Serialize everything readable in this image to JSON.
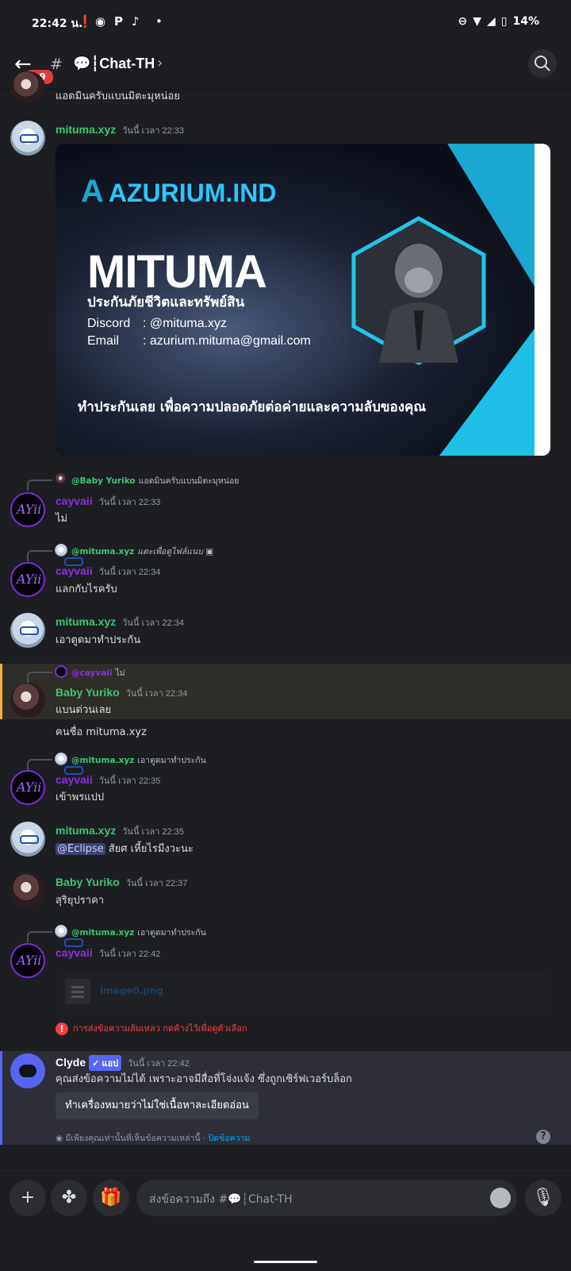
{
  "status": {
    "time": "22:42 น.",
    "battery": "14%"
  },
  "header": {
    "title": "💬┆Chat-TH",
    "badge": "99"
  },
  "messages": {
    "m0": {
      "text": "แอดมินครับแบนมิตะมุหน่อย"
    },
    "m1": {
      "name": "mituma.xyz",
      "ts": "วันนี้ เวลา 22:33"
    },
    "card": {
      "logo": "AZURIUM.IND",
      "name": "MITUMA",
      "sub": "ประกันภัยชีวิตและทรัพย์สิน",
      "discord_label": "Discord",
      "discord_value": ": @mituma.xyz",
      "email_label": "Email",
      "email_value": ": azurium.mituma@gmail.com",
      "bottom": "ทำประกันเลย เพื่อความปลอดภัยต่อค่ายและความลับของคุณ"
    },
    "m2": {
      "reply_name": "@Baby Yuriko",
      "reply_text": "แอดมินครับแบนมิตะมุหน่อย",
      "name": "cayvaii",
      "ts": "วันนี้ เวลา 22:33",
      "text": "ไม่"
    },
    "m3": {
      "reply_name": "@mituma.xyz",
      "reply_text": "แตะเพื่อดูไฟล์แนบ",
      "name": "cayvaii",
      "ts": "วันนี้ เวลา 22:34",
      "text": "แลกกับไรครับ"
    },
    "m4": {
      "name": "mituma.xyz",
      "ts": "วันนี้ เวลา 22:34",
      "text": "เอาตูดมาทำประกัน"
    },
    "m5": {
      "reply_name": "@cayvaii",
      "reply_text": "ไม่",
      "name": "Baby Yuriko",
      "ts": "วันนี้ เวลา 22:34",
      "text": "แบนด่วนเลย",
      "text2": "คนชื่อ mituma.xyz"
    },
    "m6": {
      "reply_name": "@mituma.xyz",
      "reply_text": "เอาตูดมาทำประกัน",
      "name": "cayvaii",
      "ts": "วันนี้ เวลา 22:35",
      "text": "เข้าพรแปป"
    },
    "m7": {
      "name": "mituma.xyz",
      "ts": "วันนี้ เวลา 22:35",
      "mention": "@Eclipse",
      "text": " สัยศ เหี้ยไรมีงวะนะ"
    },
    "m8": {
      "name": "Baby Yuriko",
      "ts": "วันนี้ เวลา 22:37",
      "text": "สุริยุปราคา"
    },
    "m9": {
      "reply_name": "@mituma.xyz",
      "reply_text": "เอาตูดมาทำประกัน",
      "name": "cayvaii",
      "ts": "วันนี้ เวลา 22:42",
      "file": "image0.png",
      "error": "การส่งข้อความล้มเหลว กดค้างไว้เพื่อดูตัวเลือก"
    },
    "clyde": {
      "name": "Clyde",
      "app": "✓ แอป",
      "ts": "วันนี้ เวลา 22:42",
      "text": "คุณส่งข้อความไม่ได้ เพราะอาจมีสื่อที่โจ่งแจ้ง ซึ่งถูกเซิร์ฟเวอร์บล็อก",
      "button": "ทำเครื่องหมายว่าไม่ใช่เนื้อหาละเอียดอ่อน",
      "only": "มีเพียงคุณเท่านั้นที่เห็นข้อความเหล่านี้ · ",
      "dismiss": "ปิดข้อความ"
    }
  },
  "composer": {
    "placeholder": "ส่งข้อความถึง #💬┆Chat-TH"
  }
}
